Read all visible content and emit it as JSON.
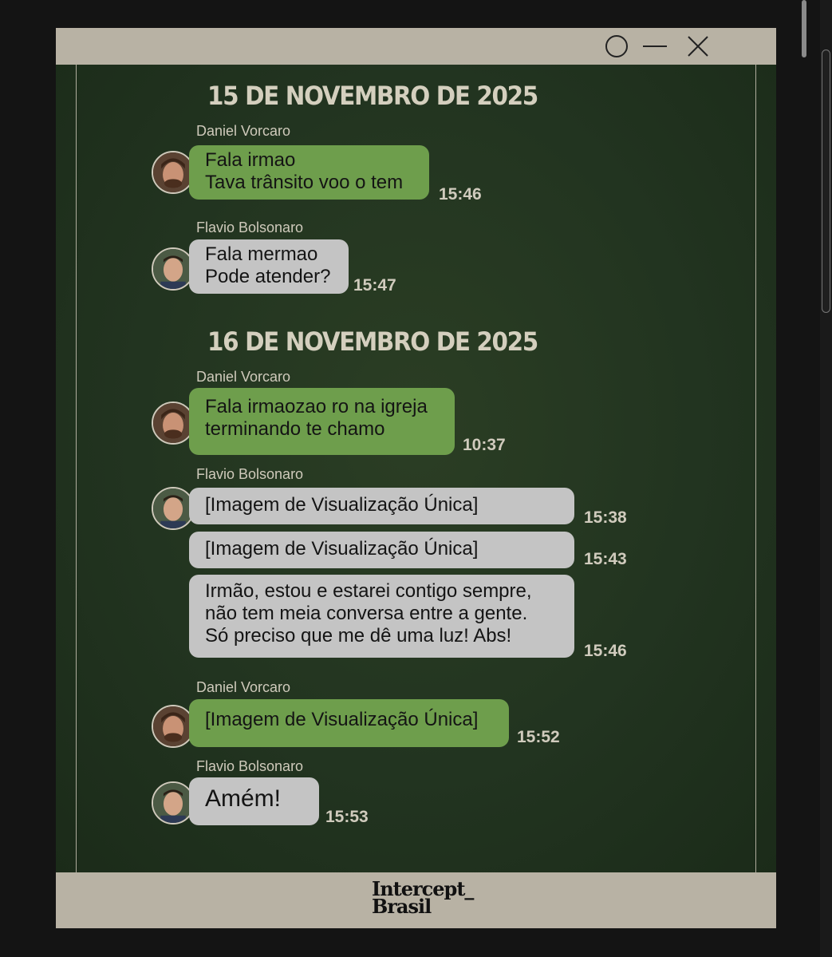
{
  "window": {
    "controls": [
      "circle-icon",
      "minimize-icon",
      "close-icon"
    ]
  },
  "chat": {
    "date1": "15 DE NOVEMBRO DE 2025",
    "date2": "16 DE NOVEMBRO DE 2025",
    "messages": [
      {
        "sender": "Daniel Vorcaro",
        "text": "Fala irmao\nTava trânsito voo o tem",
        "time": "15:46"
      },
      {
        "sender": "Flavio Bolsonaro",
        "text": "Fala mermao\nPode atender?",
        "time": "15:47"
      },
      {
        "sender": "Daniel Vorcaro",
        "text": "Fala irmaozao ro na igreja\nterminando te chamo",
        "time": "10:37"
      },
      {
        "sender": "Flavio Bolsonaro",
        "text": "[Imagem de Visualização Única]",
        "time": "15:38"
      },
      {
        "text": "[Imagem de Visualização Única]",
        "time": "15:43"
      },
      {
        "text": "Irmão, estou e estarei contigo sempre,\nnão tem meia conversa entre a gente.\nSó preciso que me dê uma luz! Abs!",
        "time": "15:46"
      },
      {
        "sender": "Daniel Vorcaro",
        "text": "[Imagem de Visualização Única]",
        "time": "15:52"
      },
      {
        "sender": "Flavio Bolsonaro",
        "text": "Amém!",
        "time": "15:53"
      }
    ]
  },
  "footer": {
    "logo_line1": "Intercept_",
    "logo_line2": "Brasil"
  },
  "colors": {
    "green_bubble": "#6e9e4c",
    "gray_bubble": "#c4c4c4",
    "background": "#223420",
    "frame": "#b8b2a4"
  }
}
